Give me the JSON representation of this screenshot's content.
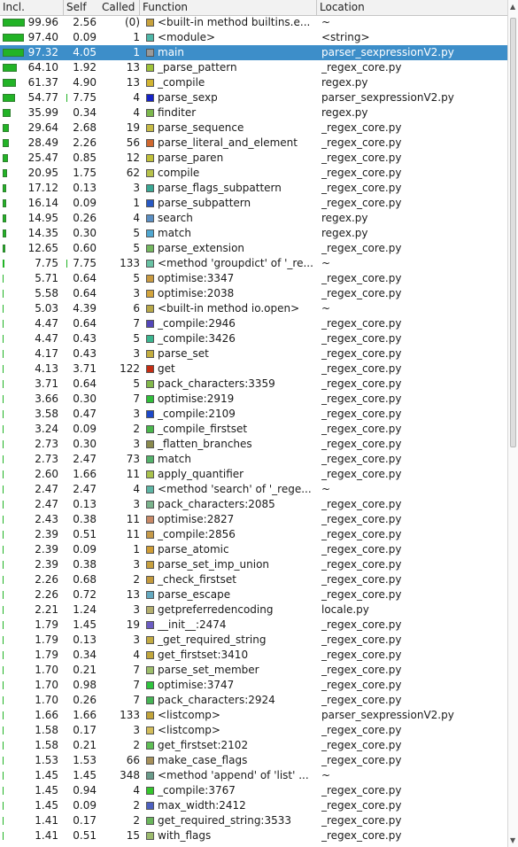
{
  "columns": {
    "incl": "Incl.",
    "self": "Self",
    "called": "Called",
    "function": "Function",
    "location": "Location"
  },
  "scrollbar": {
    "up_icon": "▲",
    "down_icon": "▼"
  },
  "colors": {
    "selection": "#3d8ec9",
    "bar": "#22b326"
  },
  "rows": [
    {
      "incl": "99.96",
      "self": "2.56",
      "called": "(0)",
      "func": "<built-in method builtins.e...",
      "loc": "~",
      "color": "#c8a23c"
    },
    {
      "incl": "97.40",
      "self": "0.09",
      "called": "1",
      "func": "<module>",
      "loc": "<string>",
      "color": "#4fb7a8"
    },
    {
      "incl": "97.32",
      "self": "4.05",
      "called": "1",
      "func": "main",
      "loc": "parser_sexpressionV2.py",
      "color": "#9a9a9a",
      "selected": true
    },
    {
      "incl": "64.10",
      "self": "1.92",
      "called": "13",
      "func": "_parse_pattern",
      "loc": "_regex_core.py",
      "color": "#9fc33a"
    },
    {
      "incl": "61.37",
      "self": "4.90",
      "called": "13",
      "func": "_compile",
      "loc": "regex.py",
      "color": "#d2b431"
    },
    {
      "incl": "54.77",
      "self": "7.75",
      "called": "4",
      "func": "parse_sexp",
      "loc": "parser_sexpressionV2.py",
      "color": "#1523c8"
    },
    {
      "incl": "35.99",
      "self": "0.34",
      "called": "4",
      "func": "finditer",
      "loc": "regex.py",
      "color": "#7cb84c"
    },
    {
      "incl": "29.64",
      "self": "2.68",
      "called": "19",
      "func": "parse_sequence",
      "loc": "_regex_core.py",
      "color": "#c6bb46"
    },
    {
      "incl": "28.49",
      "self": "2.26",
      "called": "56",
      "func": "parse_literal_and_element",
      "loc": "_regex_core.py",
      "color": "#d0672e"
    },
    {
      "incl": "25.47",
      "self": "0.85",
      "called": "12",
      "func": "parse_paren",
      "loc": "_regex_core.py",
      "color": "#c0c039"
    },
    {
      "incl": "20.95",
      "self": "1.75",
      "called": "62",
      "func": "compile",
      "loc": "_regex_core.py",
      "color": "#b7c24a"
    },
    {
      "incl": "17.12",
      "self": "0.13",
      "called": "3",
      "func": "parse_flags_subpattern",
      "loc": "_regex_core.py",
      "color": "#3aa894"
    },
    {
      "incl": "16.14",
      "self": "0.09",
      "called": "1",
      "func": "parse_subpattern",
      "loc": "_regex_core.py",
      "color": "#2859c4"
    },
    {
      "incl": "14.95",
      "self": "0.26",
      "called": "4",
      "func": "search",
      "loc": "regex.py",
      "color": "#5b8fc3"
    },
    {
      "incl": "14.35",
      "self": "0.30",
      "called": "5",
      "func": "match",
      "loc": "regex.py",
      "color": "#4fa7d1"
    },
    {
      "incl": "12.65",
      "self": "0.60",
      "called": "5",
      "func": "parse_extension",
      "loc": "_regex_core.py",
      "color": "#74b85f"
    },
    {
      "incl": "7.75",
      "self": "7.75",
      "called": "133",
      "func": "<method 'groupdict' of '_re...",
      "loc": "~",
      "color": "#68c2a4"
    },
    {
      "incl": "5.71",
      "self": "0.64",
      "called": "5",
      "func": "optimise:3347",
      "loc": "_regex_core.py",
      "color": "#c99a40"
    },
    {
      "incl": "5.58",
      "self": "0.64",
      "called": "3",
      "func": "optimise:2038",
      "loc": "_regex_core.py",
      "color": "#d3a43c"
    },
    {
      "incl": "5.03",
      "self": "4.39",
      "called": "6",
      "func": "<built-in method io.open>",
      "loc": "~",
      "color": "#b8a848"
    },
    {
      "incl": "4.47",
      "self": "0.64",
      "called": "7",
      "func": "_compile:2946",
      "loc": "_regex_core.py",
      "color": "#5346b9"
    },
    {
      "incl": "4.47",
      "self": "0.43",
      "called": "5",
      "func": "_compile:3426",
      "loc": "_regex_core.py",
      "color": "#3bb68f"
    },
    {
      "incl": "4.17",
      "self": "0.43",
      "called": "3",
      "func": "parse_set",
      "loc": "_regex_core.py",
      "color": "#c3ad3f"
    },
    {
      "incl": "4.13",
      "self": "3.71",
      "called": "122",
      "func": "get",
      "loc": "_regex_core.py",
      "color": "#c52d12"
    },
    {
      "incl": "3.71",
      "self": "0.64",
      "called": "5",
      "func": "pack_characters:3359",
      "loc": "_regex_core.py",
      "color": "#82b84b"
    },
    {
      "incl": "3.66",
      "self": "0.30",
      "called": "7",
      "func": "optimise:2919",
      "loc": "_regex_core.py",
      "color": "#2fbf3a"
    },
    {
      "incl": "3.58",
      "self": "0.47",
      "called": "3",
      "func": "_compile:2109",
      "loc": "_regex_core.py",
      "color": "#1d48c9"
    },
    {
      "incl": "3.24",
      "self": "0.09",
      "called": "2",
      "func": "_compile_firstset",
      "loc": "_regex_core.py",
      "color": "#4ab84c"
    },
    {
      "incl": "2.73",
      "self": "0.30",
      "called": "3",
      "func": "_flatten_branches",
      "loc": "_regex_core.py",
      "color": "#8a8a4e"
    },
    {
      "incl": "2.73",
      "self": "2.47",
      "called": "73",
      "func": "match",
      "loc": "_regex_core.py",
      "color": "#54b36b"
    },
    {
      "incl": "2.60",
      "self": "1.66",
      "called": "11",
      "func": "apply_quantifier",
      "loc": "_regex_core.py",
      "color": "#a9c24c"
    },
    {
      "incl": "2.47",
      "self": "2.47",
      "called": "4",
      "func": "<method 'search' of '_rege...",
      "loc": "~",
      "color": "#5db6a5"
    },
    {
      "incl": "2.47",
      "self": "0.13",
      "called": "3",
      "func": "pack_characters:2085",
      "loc": "_regex_core.py",
      "color": "#7ab38c"
    },
    {
      "incl": "2.43",
      "self": "0.38",
      "called": "11",
      "func": "optimise:2827",
      "loc": "_regex_core.py",
      "color": "#c98966"
    },
    {
      "incl": "2.39",
      "self": "0.51",
      "called": "11",
      "func": "_compile:2856",
      "loc": "_regex_core.py",
      "color": "#c69a49"
    },
    {
      "incl": "2.39",
      "self": "0.09",
      "called": "1",
      "func": "parse_atomic",
      "loc": "_regex_core.py",
      "color": "#d09d35"
    },
    {
      "incl": "2.39",
      "self": "0.38",
      "called": "3",
      "func": "parse_set_imp_union",
      "loc": "_regex_core.py",
      "color": "#c7a03f"
    },
    {
      "incl": "2.26",
      "self": "0.68",
      "called": "2",
      "func": "_check_firstset",
      "loc": "_regex_core.py",
      "color": "#c49a3c"
    },
    {
      "incl": "2.26",
      "self": "0.72",
      "called": "13",
      "func": "parse_escape",
      "loc": "_regex_core.py",
      "color": "#64a9c0"
    },
    {
      "incl": "2.21",
      "self": "1.24",
      "called": "3",
      "func": "getpreferredencoding",
      "loc": "locale.py",
      "color": "#b5b06f"
    },
    {
      "incl": "1.79",
      "self": "1.45",
      "called": "19",
      "func": "__init__:2474",
      "loc": "_regex_core.py",
      "color": "#6b5cc3"
    },
    {
      "incl": "1.79",
      "self": "0.13",
      "called": "3",
      "func": "_get_required_string",
      "loc": "_regex_core.py",
      "color": "#c3ab42"
    },
    {
      "incl": "1.79",
      "self": "0.34",
      "called": "4",
      "func": "get_firstset:3410",
      "loc": "_regex_core.py",
      "color": "#c1a63c"
    },
    {
      "incl": "1.70",
      "self": "0.21",
      "called": "7",
      "func": "parse_set_member",
      "loc": "_regex_core.py",
      "color": "#9ebf6b"
    },
    {
      "incl": "1.70",
      "self": "0.98",
      "called": "7",
      "func": "optimise:3747",
      "loc": "_regex_core.py",
      "color": "#2ec43e"
    },
    {
      "incl": "1.70",
      "self": "0.26",
      "called": "7",
      "func": "pack_characters:2924",
      "loc": "_regex_core.py",
      "color": "#45b555"
    },
    {
      "incl": "1.66",
      "self": "1.66",
      "called": "133",
      "func": "<listcomp>",
      "loc": "parser_sexpressionV2.py",
      "color": "#c2a43a"
    },
    {
      "incl": "1.58",
      "self": "0.17",
      "called": "3",
      "func": "<listcomp>",
      "loc": "_regex_core.py",
      "color": "#d3bd5a"
    },
    {
      "incl": "1.58",
      "self": "0.21",
      "called": "2",
      "func": "get_firstset:2102",
      "loc": "_regex_core.py",
      "color": "#5fbf56"
    },
    {
      "incl": "1.53",
      "self": "1.53",
      "called": "66",
      "func": "make_case_flags",
      "loc": "_regex_core.py",
      "color": "#a8915a"
    },
    {
      "incl": "1.45",
      "self": "1.45",
      "called": "348",
      "func": "<method 'append' of 'list' ...",
      "loc": "~",
      "color": "#6a9c8b"
    },
    {
      "incl": "1.45",
      "self": "0.94",
      "called": "4",
      "func": "_compile:3767",
      "loc": "_regex_core.py",
      "color": "#34c72b"
    },
    {
      "incl": "1.45",
      "self": "0.09",
      "called": "2",
      "func": "max_width:2412",
      "loc": "_regex_core.py",
      "color": "#4d60c0"
    },
    {
      "incl": "1.41",
      "self": "0.17",
      "called": "2",
      "func": "get_required_string:3533",
      "loc": "_regex_core.py",
      "color": "#6ab75c"
    },
    {
      "incl": "1.41",
      "self": "0.51",
      "called": "15",
      "func": "with_flags",
      "loc": "_regex_core.py",
      "color": "#9cbb6e"
    }
  ]
}
